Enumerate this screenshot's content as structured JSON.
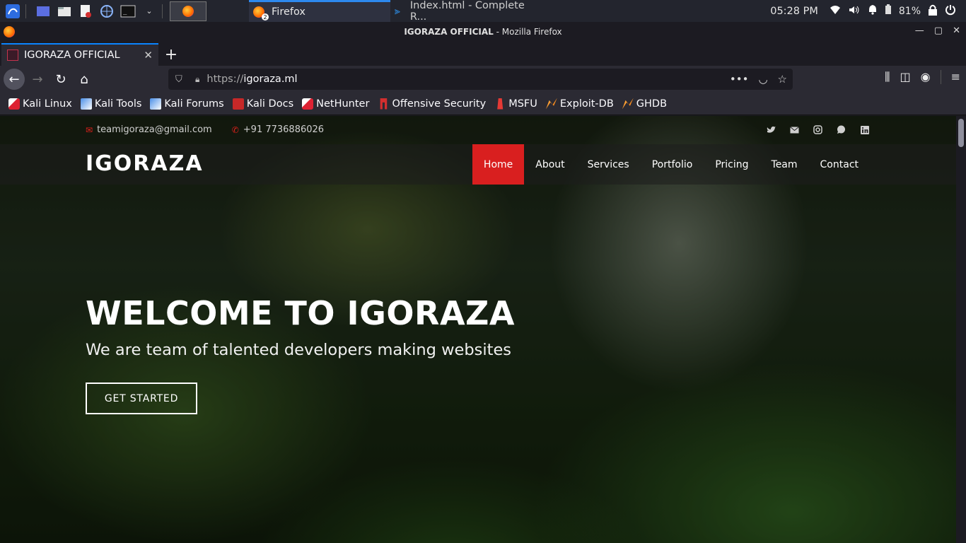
{
  "taskbar": {
    "tasks": [
      {
        "label": "Firefox",
        "badge": "2"
      },
      {
        "label": "Index.html - Complete R..."
      }
    ],
    "clock": "05:28 PM",
    "battery": "81%"
  },
  "window": {
    "title_strong": "IGORAZA OFFICIAL",
    "title_rest": " - Mozilla Firefox"
  },
  "tab": {
    "label": "IGORAZA OFFICIAL"
  },
  "urlbar": {
    "protocol": "https://",
    "host": "igoraza.ml"
  },
  "bookmarks": [
    {
      "label": "Kali Linux",
      "icon": "kali-icon"
    },
    {
      "label": "Kali Tools",
      "icon": "kali-tools-icon"
    },
    {
      "label": "Kali Forums",
      "icon": "kali-forums-icon"
    },
    {
      "label": "Kali Docs",
      "icon": "kali-docs-icon"
    },
    {
      "label": "NetHunter",
      "icon": "nethunter-icon"
    },
    {
      "label": "Offensive Security",
      "icon": "offsec-icon"
    },
    {
      "label": "MSFU",
      "icon": "msfu-icon"
    },
    {
      "label": "Exploit-DB",
      "icon": "exploitdb-icon"
    },
    {
      "label": "GHDB",
      "icon": "ghdb-icon"
    }
  ],
  "site": {
    "email": "teamigoraza@gmail.com",
    "phone": "+91 7736886026",
    "logo": "IGORAZA",
    "menu": [
      "Home",
      "About",
      "Services",
      "Portfolio",
      "Pricing",
      "Team",
      "Contact"
    ],
    "active_menu": "Home",
    "hero_title": "WELCOME TO IGORAZA",
    "hero_subtitle": "We are team of talented developers making websites",
    "cta": "GET STARTED",
    "accent_color": "#d91f1f"
  }
}
